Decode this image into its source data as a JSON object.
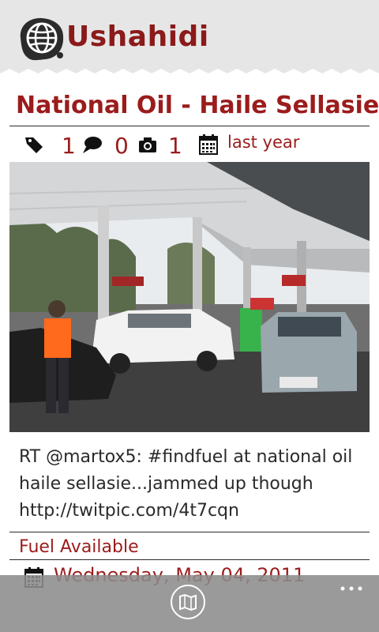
{
  "app": {
    "brand": "Ushahidi"
  },
  "report": {
    "title": "National Oil - Haile Sellasie",
    "stats": {
      "tag_count": "1",
      "comment_count": "0",
      "photo_count": "1",
      "date_relative": "last year"
    },
    "description": "RT @martox5: #findfuel at national oil haile sellasie...jammed up though http://twitpic.com/4t7cqn",
    "category": "Fuel Available",
    "date": "Wednesday, May 04, 2011"
  },
  "icons": {
    "tag": "tag-icon",
    "comment": "comment-icon",
    "photo": "camera-icon",
    "date": "calendar-icon",
    "map": "map-icon",
    "more": "more-icon"
  },
  "colors": {
    "accent": "#9b1c1c",
    "header_bg": "#e6e6e6",
    "appbar_bg": "#8c8c8c"
  }
}
